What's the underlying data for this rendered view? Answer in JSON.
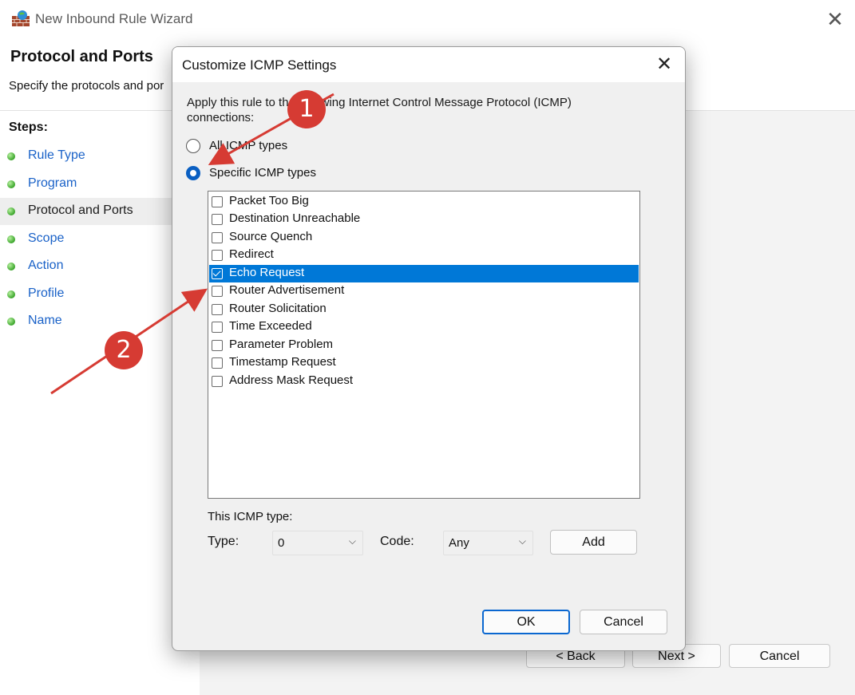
{
  "wizard": {
    "title": "New Inbound Rule Wizard",
    "heading": "Protocol and Ports",
    "subheading": "Specify the protocols and por",
    "steps_label": "Steps:",
    "steps": [
      {
        "label": "Rule Type"
      },
      {
        "label": "Program"
      },
      {
        "label": "Protocol and Ports",
        "current": true
      },
      {
        "label": "Scope"
      },
      {
        "label": "Action"
      },
      {
        "label": "Profile"
      },
      {
        "label": "Name"
      }
    ],
    "buttons": {
      "back": "< Back",
      "next": "Next >",
      "cancel": "Cancel"
    }
  },
  "dialog": {
    "title": "Customize ICMP Settings",
    "description": "Apply this rule to the following Internet Control Message Protocol (ICMP) connections:",
    "radio_all": "All ICMP types",
    "radio_specific": "Specific ICMP types",
    "selected_radio": "specific",
    "icmp_types": [
      {
        "label": "Packet Too Big",
        "checked": false
      },
      {
        "label": "Destination Unreachable",
        "checked": false
      },
      {
        "label": "Source Quench",
        "checked": false
      },
      {
        "label": "Redirect",
        "checked": false
      },
      {
        "label": "Echo Request",
        "checked": true,
        "selected": true
      },
      {
        "label": "Router Advertisement",
        "checked": false
      },
      {
        "label": "Router Solicitation",
        "checked": false
      },
      {
        "label": "Time Exceeded",
        "checked": false
      },
      {
        "label": "Parameter Problem",
        "checked": false
      },
      {
        "label": "Timestamp Request",
        "checked": false
      },
      {
        "label": "Address Mask Request",
        "checked": false
      }
    ],
    "this_type_label": "This ICMP type:",
    "type_label": "Type:",
    "type_value": "0",
    "code_label": "Code:",
    "code_value": "Any",
    "add_label": "Add",
    "ok_label": "OK",
    "cancel_label": "Cancel"
  },
  "annotations": {
    "badge_1": "1",
    "badge_2": "2",
    "color": "#d63b33"
  },
  "colors": {
    "accent": "#0078d7",
    "step_link": "#1a62c8"
  }
}
